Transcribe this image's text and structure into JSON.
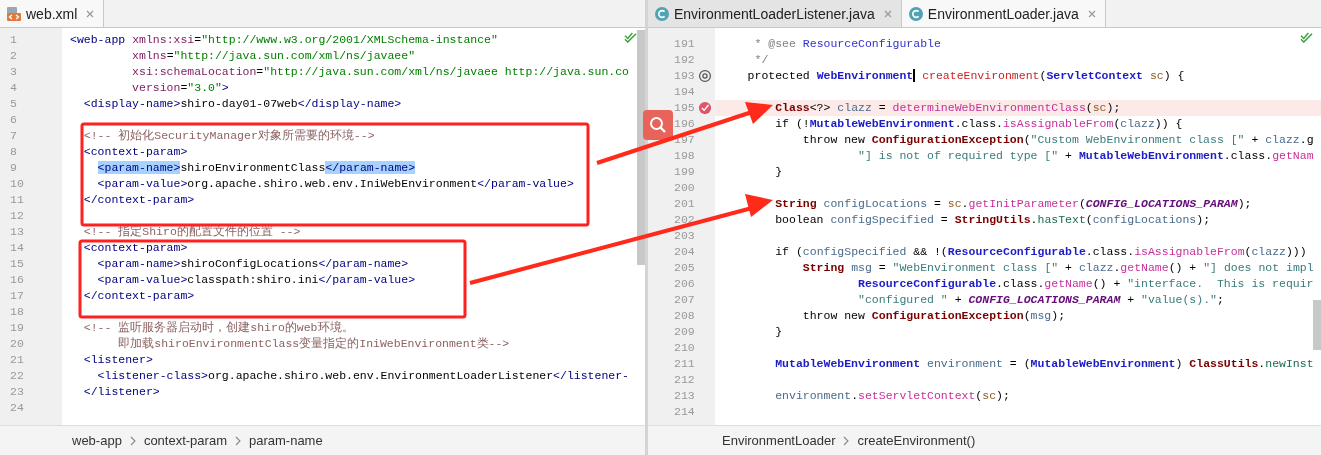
{
  "panes": [
    {
      "tabs": [
        {
          "label": "web.xml",
          "kind": "xml",
          "selected": true
        }
      ],
      "lines": [
        {
          "number": "1",
          "kind": "plain",
          "highlighted": false,
          "tokens": [
            {
              "kind": "tag",
              "text": "<web-app "
            },
            {
              "kind": "attr",
              "text": "xmlns:xsi"
            },
            {
              "kind": "text",
              "text": "="
            },
            {
              "kind": "val",
              "text": "\"http://www.w3.org/2001/XMLSchema-instance\""
            }
          ]
        },
        {
          "number": "2",
          "kind": "plain",
          "highlighted": false,
          "tokens": [
            {
              "kind": "attr",
              "text": "         xmlns"
            },
            {
              "kind": "text",
              "text": "="
            },
            {
              "kind": "val",
              "text": "\"http://java.sun.com/xml/ns/javaee\""
            }
          ]
        },
        {
          "number": "3",
          "kind": "plain",
          "highlighted": false,
          "tokens": [
            {
              "kind": "attr",
              "text": "         xsi:schemaLocation"
            },
            {
              "kind": "text",
              "text": "="
            },
            {
              "kind": "val",
              "text": "\"http://java.sun.com/xml/ns/javaee http://java.sun.co"
            }
          ]
        },
        {
          "number": "4",
          "kind": "plain",
          "highlighted": false,
          "tokens": [
            {
              "kind": "attr",
              "text": "         version"
            },
            {
              "kind": "text",
              "text": "="
            },
            {
              "kind": "val",
              "text": "\"3.0\""
            },
            {
              "kind": "tag",
              "text": ">"
            }
          ]
        },
        {
          "number": "5",
          "kind": "plain",
          "highlighted": false,
          "tokens": [
            {
              "kind": "tag",
              "text": "  <display-name>"
            },
            {
              "kind": "text",
              "text": "shiro-day01-07web"
            },
            {
              "kind": "tag",
              "text": "</display-name>"
            }
          ]
        },
        {
          "number": "6",
          "kind": "plain",
          "highlighted": false
        },
        {
          "number": "7",
          "kind": "plain",
          "highlighted": false,
          "tokens": [
            {
              "kind": "comment",
              "text": "  <!-- 初始化SecurityManager对象所需要的环境-->"
            }
          ]
        },
        {
          "number": "8",
          "kind": "plain",
          "highlighted": false,
          "tokens": [
            {
              "kind": "tag",
              "text": "  <context-param>"
            }
          ]
        },
        {
          "number": "9",
          "kind": "plain",
          "highlighted": false,
          "tokens": [
            {
              "kind": "tag-selected",
              "text": "    <param-name>"
            },
            {
              "kind": "text",
              "text": "shiroEnvironmentClass"
            },
            {
              "kind": "tag-selected",
              "text": "</param-name>"
            }
          ]
        },
        {
          "number": "10",
          "kind": "plain",
          "highlighted": false,
          "tokens": [
            {
              "kind": "tag",
              "text": "    <param-value>"
            },
            {
              "kind": "text",
              "text": "org.apache.shiro.web.env.IniWebEnvironment"
            },
            {
              "kind": "tag",
              "text": "</param-value>"
            }
          ]
        },
        {
          "number": "11",
          "kind": "plain",
          "highlighted": false,
          "tokens": [
            {
              "kind": "tag",
              "text": "  </context-param>"
            }
          ]
        },
        {
          "number": "12",
          "kind": "plain",
          "highlighted": false
        },
        {
          "number": "13",
          "kind": "plain",
          "highlighted": false,
          "tokens": [
            {
              "kind": "comment",
              "text": "  <!-- 指定Shiro的配置文件的位置 -->"
            }
          ]
        },
        {
          "number": "14",
          "kind": "plain",
          "highlighted": false,
          "tokens": [
            {
              "kind": "tag",
              "text": "  <context-param>"
            }
          ]
        },
        {
          "number": "15",
          "kind": "plain",
          "highlighted": false,
          "tokens": [
            {
              "kind": "tag",
              "text": "    <param-name>"
            },
            {
              "kind": "text",
              "text": "shiroConfigLocations"
            },
            {
              "kind": "tag",
              "text": "</param-name>"
            }
          ]
        },
        {
          "number": "16",
          "kind": "plain",
          "highlighted": false,
          "tokens": [
            {
              "kind": "tag",
              "text": "    <param-value>"
            },
            {
              "kind": "text",
              "text": "classpath:shiro.ini"
            },
            {
              "kind": "tag",
              "text": "</param-value>"
            }
          ]
        },
        {
          "number": "17",
          "kind": "plain",
          "highlighted": false,
          "tokens": [
            {
              "kind": "tag",
              "text": "  </context-param>"
            }
          ]
        },
        {
          "number": "18",
          "kind": "plain",
          "highlighted": false
        },
        {
          "number": "19",
          "kind": "plain",
          "highlighted": false,
          "tokens": [
            {
              "kind": "comment",
              "text": "  <!-- 监听服务器启动时，创建shiro的web环境。"
            }
          ]
        },
        {
          "number": "20",
          "kind": "plain",
          "highlighted": false,
          "tokens": [
            {
              "kind": "comment",
              "text": "       即加载shiroEnvironmentClass变量指定的IniWebEnvironment类-->"
            }
          ]
        },
        {
          "number": "21",
          "kind": "plain",
          "highlighted": false,
          "tokens": [
            {
              "kind": "tag",
              "text": "  <listener>"
            }
          ]
        },
        {
          "number": "22",
          "kind": "plain",
          "highlighted": false,
          "tokens": [
            {
              "kind": "tag",
              "text": "    <listener-class>"
            },
            {
              "kind": "text",
              "text": "org.apache.shiro.web.env.EnvironmentLoaderListener"
            },
            {
              "kind": "tag",
              "text": "</listener-"
            }
          ]
        },
        {
          "number": "23",
          "kind": "plain",
          "highlighted": false,
          "tokens": [
            {
              "kind": "tag",
              "text": "  </listener>"
            }
          ]
        },
        {
          "number": "24",
          "kind": "plain",
          "highlighted": false
        }
      ],
      "breadcrumbs": [
        "web-app",
        "context-param",
        "param-name"
      ]
    },
    {
      "tabs": [
        {
          "label": "EnvironmentLoaderListener.java",
          "kind": "class",
          "selected": false
        },
        {
          "label": "EnvironmentLoader.java",
          "kind": "class",
          "selected": true
        }
      ],
      "lines": [
        {
          "number": "191",
          "kind": "plain",
          "highlighted": false,
          "tokens": [
            {
              "kind": "doc",
              "text": "     * @see "
            },
            {
              "kind": "doc-link",
              "text": "ResourceConfigurable"
            }
          ]
        },
        {
          "number": "192",
          "kind": "plain",
          "highlighted": false,
          "tokens": [
            {
              "kind": "doc",
              "text": "     */"
            }
          ]
        },
        {
          "number": "193",
          "kind": "override",
          "highlighted": false,
          "tokens": [
            {
              "kind": "kw",
              "text": "    protected "
            },
            {
              "kind": "type",
              "text": "WebEnvironment"
            },
            {
              "kind": "decl-cursor",
              "text": " createEnvironment"
            },
            {
              "kind": "text",
              "text": "("
            },
            {
              "kind": "type",
              "text": "ServletContext"
            },
            {
              "kind": "param",
              "text": " sc"
            },
            {
              "kind": "text",
              "text": ") {"
            }
          ]
        },
        {
          "number": "194",
          "kind": "plain",
          "highlighted": false
        },
        {
          "number": "195",
          "kind": "breakpoint",
          "highlighted": true,
          "tokens": [
            {
              "kind": "cls",
              "text": "        Class"
            },
            {
              "kind": "text",
              "text": "<?> "
            },
            {
              "kind": "var",
              "text": "clazz"
            },
            {
              "kind": "text",
              "text": " = "
            },
            {
              "kind": "method",
              "text": "determineWebEnvironmentClass"
            },
            {
              "kind": "text",
              "text": "("
            },
            {
              "kind": "param",
              "text": "sc"
            },
            {
              "kind": "text",
              "text": ");"
            }
          ]
        },
        {
          "number": "196",
          "kind": "plain",
          "highlighted": false,
          "tokens": [
            {
              "kind": "kw",
              "text": "        if (!"
            },
            {
              "kind": "type",
              "text": "MutableWebEnvironment"
            },
            {
              "kind": "text",
              "text": ".class."
            },
            {
              "kind": "method",
              "text": "isAssignableFrom"
            },
            {
              "kind": "text",
              "text": "("
            },
            {
              "kind": "var",
              "text": "clazz"
            },
            {
              "kind": "text",
              "text": ")) {"
            }
          ]
        },
        {
          "number": "197",
          "kind": "plain",
          "highlighted": false,
          "tokens": [
            {
              "kind": "kw",
              "text": "            throw new "
            },
            {
              "kind": "cls",
              "text": "ConfigurationException"
            },
            {
              "kind": "text",
              "text": "("
            },
            {
              "kind": "str",
              "text": "\"Custom WebEnvironment class [\""
            },
            {
              "kind": "text",
              "text": " + "
            },
            {
              "kind": "var",
              "text": "clazz"
            },
            {
              "kind": "text",
              "text": ".g"
            }
          ]
        },
        {
          "number": "198",
          "kind": "plain",
          "highlighted": false,
          "tokens": [
            {
              "kind": "str",
              "text": "                    \"] is not of required type [\""
            },
            {
              "kind": "text",
              "text": " + "
            },
            {
              "kind": "type",
              "text": "MutableWebEnvironment"
            },
            {
              "kind": "text",
              "text": ".class."
            },
            {
              "kind": "method",
              "text": "getNam"
            }
          ]
        },
        {
          "number": "199",
          "kind": "plain",
          "highlighted": false,
          "tokens": [
            {
              "kind": "text",
              "text": "        }"
            }
          ]
        },
        {
          "number": "200",
          "kind": "plain",
          "highlighted": false
        },
        {
          "number": "201",
          "kind": "plain",
          "highlighted": false,
          "tokens": [
            {
              "kind": "cls",
              "text": "        String"
            },
            {
              "kind": "var",
              "text": " configLocations"
            },
            {
              "kind": "text",
              "text": " = "
            },
            {
              "kind": "param",
              "text": "sc"
            },
            {
              "kind": "text",
              "text": "."
            },
            {
              "kind": "method",
              "text": "getInitParameter"
            },
            {
              "kind": "text",
              "text": "("
            },
            {
              "kind": "const",
              "text": "CONFIG_LOCATIONS_PARAM"
            },
            {
              "kind": "text",
              "text": ");"
            }
          ]
        },
        {
          "number": "202",
          "kind": "plain",
          "highlighted": false,
          "tokens": [
            {
              "kind": "kw",
              "text": "        boolean "
            },
            {
              "kind": "var",
              "text": "configSpecified"
            },
            {
              "kind": "text",
              "text": " = "
            },
            {
              "kind": "cls",
              "text": "StringUtils"
            },
            {
              "kind": "text",
              "text": "."
            },
            {
              "kind": "static",
              "text": "hasText"
            },
            {
              "kind": "text",
              "text": "("
            },
            {
              "kind": "var",
              "text": "configLocations"
            },
            {
              "kind": "text",
              "text": ");"
            }
          ]
        },
        {
          "number": "203",
          "kind": "plain",
          "highlighted": false
        },
        {
          "number": "204",
          "kind": "plain",
          "highlighted": false,
          "tokens": [
            {
              "kind": "kw",
              "text": "        if ("
            },
            {
              "kind": "var",
              "text": "configSpecified"
            },
            {
              "kind": "text",
              "text": " && !("
            },
            {
              "kind": "type",
              "text": "ResourceConfigurable"
            },
            {
              "kind": "text",
              "text": ".class."
            },
            {
              "kind": "method",
              "text": "isAssignableFrom"
            },
            {
              "kind": "text",
              "text": "("
            },
            {
              "kind": "var",
              "text": "clazz"
            },
            {
              "kind": "text",
              "text": ")))"
            }
          ]
        },
        {
          "number": "205",
          "kind": "plain",
          "highlighted": false,
          "tokens": [
            {
              "kind": "cls",
              "text": "            String"
            },
            {
              "kind": "var",
              "text": " msg"
            },
            {
              "kind": "text",
              "text": " = "
            },
            {
              "kind": "str",
              "text": "\"WebEnvironment class [\""
            },
            {
              "kind": "text",
              "text": " + "
            },
            {
              "kind": "var",
              "text": "clazz"
            },
            {
              "kind": "text",
              "text": "."
            },
            {
              "kind": "method",
              "text": "getName"
            },
            {
              "kind": "text",
              "text": "() + "
            },
            {
              "kind": "str",
              "text": "\"] does not impl"
            }
          ]
        },
        {
          "number": "206",
          "kind": "plain",
          "highlighted": false,
          "tokens": [
            {
              "kind": "type",
              "text": "                    ResourceConfigurable"
            },
            {
              "kind": "text",
              "text": ".class."
            },
            {
              "kind": "method",
              "text": "getName"
            },
            {
              "kind": "text",
              "text": "() + "
            },
            {
              "kind": "str",
              "text": "\"interface.  This is requir"
            }
          ]
        },
        {
          "number": "207",
          "kind": "plain",
          "highlighted": false,
          "tokens": [
            {
              "kind": "str",
              "text": "                    \"configured \""
            },
            {
              "kind": "text",
              "text": " + "
            },
            {
              "kind": "const",
              "text": "CONFIG_LOCATIONS_PARAM"
            },
            {
              "kind": "text",
              "text": " + "
            },
            {
              "kind": "str",
              "text": "\"value(s).\""
            },
            {
              "kind": "text",
              "text": ";"
            }
          ]
        },
        {
          "number": "208",
          "kind": "plain",
          "highlighted": false,
          "tokens": [
            {
              "kind": "kw",
              "text": "            throw new "
            },
            {
              "kind": "cls",
              "text": "ConfigurationException"
            },
            {
              "kind": "text",
              "text": "("
            },
            {
              "kind": "var",
              "text": "msg"
            },
            {
              "kind": "text",
              "text": ");"
            }
          ]
        },
        {
          "number": "209",
          "kind": "plain",
          "highlighted": false,
          "tokens": [
            {
              "kind": "text",
              "text": "        }"
            }
          ]
        },
        {
          "number": "210",
          "kind": "plain",
          "highlighted": false
        },
        {
          "number": "211",
          "kind": "plain",
          "highlighted": false,
          "tokens": [
            {
              "kind": "type",
              "text": "        MutableWebEnvironment"
            },
            {
              "kind": "var",
              "text": " environment"
            },
            {
              "kind": "text",
              "text": " = ("
            },
            {
              "kind": "type",
              "text": "MutableWebEnvironment"
            },
            {
              "kind": "text",
              "text": ") "
            },
            {
              "kind": "cls",
              "text": "ClassUtils"
            },
            {
              "kind": "text",
              "text": "."
            },
            {
              "kind": "static",
              "text": "newInst"
            }
          ]
        },
        {
          "number": "212",
          "kind": "plain",
          "highlighted": false
        },
        {
          "number": "213",
          "kind": "plain",
          "highlighted": false,
          "tokens": [
            {
              "kind": "var",
              "text": "        environment"
            },
            {
              "kind": "text",
              "text": "."
            },
            {
              "kind": "method",
              "text": "setServletContext"
            },
            {
              "kind": "text",
              "text": "("
            },
            {
              "kind": "param",
              "text": "sc"
            },
            {
              "kind": "text",
              "text": ");"
            }
          ]
        },
        {
          "number": "214",
          "kind": "plain",
          "highlighted": false
        }
      ],
      "breadcrumbs": [
        "EnvironmentLoader",
        "createEnvironment()"
      ]
    }
  ]
}
